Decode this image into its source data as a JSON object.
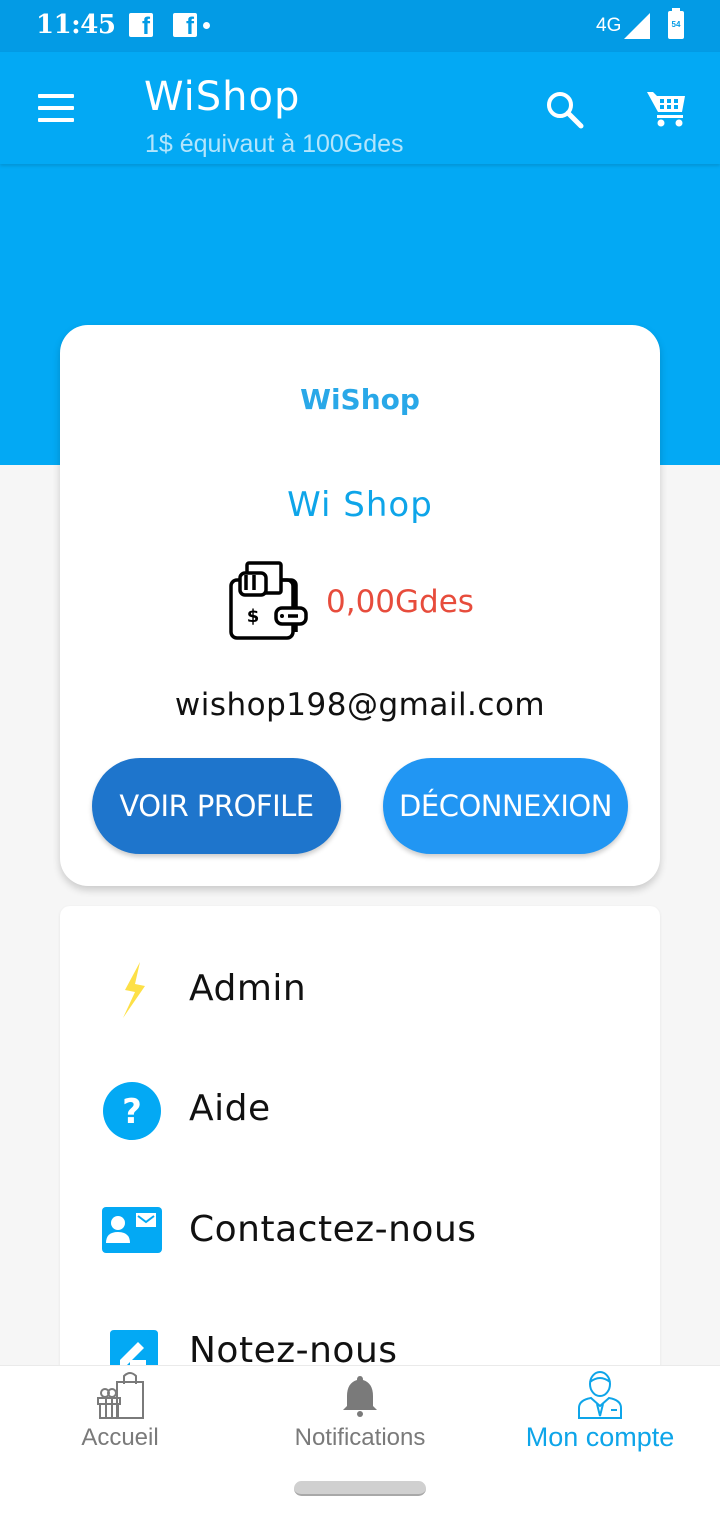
{
  "status_bar": {
    "time": "11:45",
    "notification_icons": [
      "facebook-icon",
      "facebook-icon"
    ],
    "network": "4G",
    "battery_label": "54"
  },
  "app_bar": {
    "title": "WiShop",
    "subtitle": "1$ équivaut à 100Gdes",
    "icons": [
      "menu-icon",
      "search-icon",
      "cart-icon"
    ]
  },
  "profile": {
    "logo_text": "WiShop",
    "shop_name": "Wi Shop",
    "balance": "0,00Gdes",
    "email": "wishop198@gmail.com",
    "view_profile_label": "VOIR PROFILE",
    "logout_label": "DÉCONNEXION"
  },
  "menu": {
    "items": [
      {
        "label": "Admin",
        "icon": "lightning-icon"
      },
      {
        "label": "Aide",
        "icon": "help-icon"
      },
      {
        "label": "Contactez-nous",
        "icon": "contact-card-icon"
      },
      {
        "label": "Notez-nous",
        "icon": "rate-edit-icon"
      }
    ]
  },
  "bottom_nav": {
    "items": [
      {
        "label": "Accueil",
        "icon": "shopping-gift-icon",
        "active": false
      },
      {
        "label": "Notifications",
        "icon": "bell-icon",
        "active": false
      },
      {
        "label": "Mon compte",
        "icon": "account-user-icon",
        "active": true
      }
    ]
  },
  "colors": {
    "primary": "#03a9f4",
    "status_bar": "#039be5",
    "accent_text": "#0ea5e9",
    "balance": "#e74c3c",
    "button_profile": "#1e75cc",
    "button_logout": "#2196f3",
    "admin_icon": "#fdd835",
    "inactive_nav": "#7a7a7a"
  }
}
